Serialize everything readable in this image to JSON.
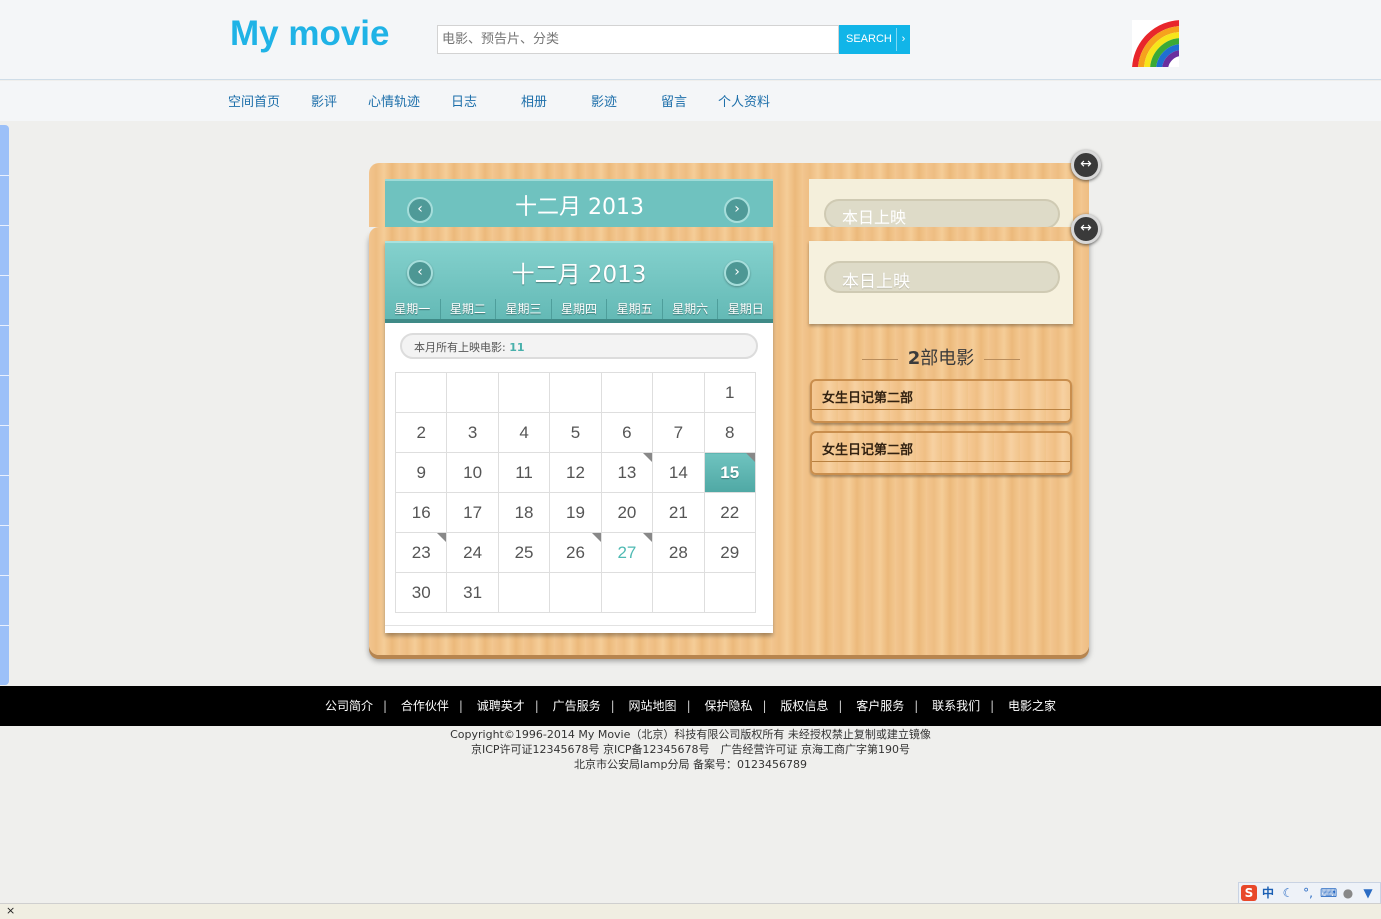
{
  "header": {
    "logo": "My movie",
    "search": {
      "placeholder": "电影、预告片、分类",
      "button": "SEARCH",
      "arrow": "›"
    }
  },
  "nav": [
    {
      "label": "空间首页"
    },
    {
      "label": "影评"
    },
    {
      "label": "心情轨迹"
    },
    {
      "label": "日志"
    },
    {
      "label": "相册"
    },
    {
      "label": "影迹"
    },
    {
      "label": "留言"
    },
    {
      "label": "个人资料"
    }
  ],
  "calendar": {
    "title": "十二月 2013",
    "prev": "‹",
    "next": "›",
    "weekdays": [
      "星期一",
      "星期二",
      "星期三",
      "星期四",
      "星期五",
      "星期六",
      "星期日"
    ],
    "month_count_label": "本月所有上映电影: ",
    "month_count": "11",
    "weeks": [
      [
        "",
        "",
        "",
        "",
        "",
        "",
        "1"
      ],
      [
        "2",
        "3",
        "4",
        "5",
        "6",
        "7",
        "8"
      ],
      [
        "9",
        "10",
        "11",
        "12",
        "13",
        "14",
        "15"
      ],
      [
        "16",
        "17",
        "18",
        "19",
        "20",
        "21",
        "22"
      ],
      [
        "23",
        "24",
        "25",
        "26",
        "27",
        "28",
        "29"
      ],
      [
        "30",
        "31",
        "",
        "",
        "",
        "",
        ""
      ]
    ],
    "today": "15",
    "highlight": "27",
    "marked": [
      "13",
      "15",
      "23",
      "26",
      "27"
    ]
  },
  "today_panel": {
    "label": "本日上映",
    "count_number": "2",
    "count_suffix": "部电影",
    "movies": [
      "女生日记第二部",
      "女生日记第二部"
    ]
  },
  "footer": {
    "links": [
      "公司简介",
      "合作伙伴",
      "诚聘英才",
      "广告服务",
      "网站地图",
      "保护隐私",
      "版权信息",
      "客户服务",
      "联系我们",
      "电影之家"
    ],
    "separator": "|",
    "copyright_lines": [
      "Copyright©1996-2014 My Movie（北京）科技有限公司版权所有 未经授权禁止复制或建立镜像",
      "京ICP许可证12345678号 京ICP备12345678号　广告经营许可证 京海工商广字第190号",
      "北京市公安局lamp分局 备案号：0123456789"
    ]
  },
  "ime": {
    "logo": "S",
    "mode": "中",
    "punct": "°,"
  },
  "bottom_bar": {
    "close": "×"
  },
  "colors": {
    "accent": "#1fb3e6",
    "calendar_teal": "#63b9b5",
    "wood": "#f2c58f",
    "footer": "#000000"
  },
  "icons": {
    "resize": "horizontal-arrows-icon",
    "search_arrow": "chevron-right-icon"
  }
}
